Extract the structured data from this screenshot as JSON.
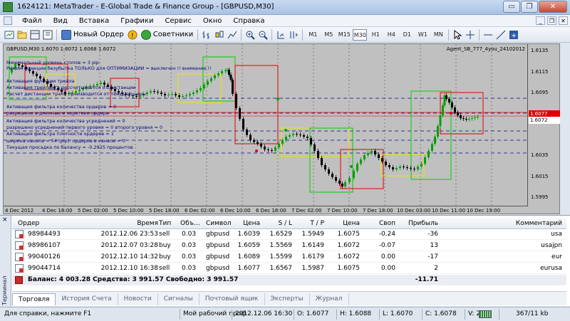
{
  "window": {
    "title": "1624121: MetaTrader - E-Global Trade & Finance Group - [GBPUSD,M30]",
    "buttons": [
      "▭",
      "❐",
      "✕"
    ]
  },
  "menu": {
    "items": [
      "Файл",
      "Вид",
      "Вставка",
      "Графики",
      "Сервис",
      "Окно",
      "Справка"
    ],
    "mdi_buttons": [
      "_",
      "❐",
      "✕"
    ]
  },
  "toolbar": {
    "new_order_label": "Новый Ордер",
    "experts_label": "Советники",
    "timeframes": [
      "M1",
      "M5",
      "M15",
      "M30",
      "H1",
      "H4",
      "D1",
      "W1",
      "MN"
    ],
    "active_timeframe": "M30"
  },
  "chart": {
    "symbol_header": "GBPUSD,M30  1.6070 1.6072 1.6068 1.6072",
    "ea_name": "Agent_SB_777_4you_24102012",
    "comments": [
      "Минимальный уровень стопов = 3 pip",
      "Режим функции безубытка ТОЛЬКО для ОПТИМИЗАЦИИ = выключен !! внимание !!",
      "Активация функции трейла",
      "Активация трейлинга рассчитывается от дистанции",
      "Расчет дистанции трала производится от текущей цены",
      "Активация фильтра количества ордеров = 0",
      "разрешено в длинные и короткие ордера",
      "Активация фильтра количества усреднений = 0",
      "разрешено усреднений первого уровня = 0 второго уровня = 0",
      "Активация фильтра плотности ордеров = 1",
      "ширина канала = 54 (pip), ордеров в канале = 0",
      "Текущая просадка по балансу = -0.2925 процентов"
    ],
    "price_labels": [
      "1.6135",
      "1.6115",
      "1.6095",
      "1.6035",
      "1.6015",
      "1.5995"
    ],
    "price_tag_red": "1.6077",
    "price_tag_white": "1.6072",
    "time_labels": [
      "4 Dec 2012",
      "4 Dec 18:00",
      "5 Dec 02:00",
      "5 Dec 10:00",
      "5 Dec 18:00",
      "6 Dec 02:00",
      "6 Dec 10:00",
      "6 Dec 18:00",
      "7 Dec 02:00",
      "7 Dec 10:00",
      "7 Dec 18:00",
      "10 Dec 03:00",
      "10 Dec 11:00",
      "10 Dec 19:00"
    ],
    "colors": {
      "background": "#c0c0c0",
      "bull": "#00a000",
      "bear": "#000000",
      "red_box": "#e00000",
      "green_box": "#00d000",
      "yellow_box": "#e8e800",
      "dashed": "#000080"
    }
  },
  "terminal": {
    "side_label": "Терминал",
    "columns": [
      "Ордер",
      "Время",
      "Тип",
      "Объ...",
      "Символ",
      "Цена",
      "S / L",
      "T / P",
      "Цена",
      "Своп",
      "Прибыль",
      "Комментарий"
    ],
    "rows": [
      [
        "98984493",
        "2012.12.06 23:53",
        "sell",
        "0.03",
        "gbpusd",
        "1.6039",
        "1.6529",
        "1.5949",
        "1.6075",
        "-0.24",
        "-36",
        "usa"
      ],
      [
        "98986107",
        "2012.12.07 03:28",
        "buy",
        "0.03",
        "gbpusd",
        "1.6059",
        "1.5569",
        "1.6149",
        "1.6072",
        "-0.07",
        "13",
        "usajpn"
      ],
      [
        "99040126",
        "2012.12.10 14:32",
        "buy",
        "0.03",
        "gbpusd",
        "1.6089",
        "1.5599",
        "1.6179",
        "1.6072",
        "0.00",
        "-17",
        "eur"
      ],
      [
        "99044714",
        "2012.12.10 16:38",
        "sell",
        "0.03",
        "gbpusd",
        "1.6077",
        "1.6567",
        "1.5987",
        "1.6075",
        "0.00",
        "2",
        "eurusa"
      ]
    ],
    "balance_text": "Баланс: 4 003.28  Средства: 3 991.57  Свободно: 3 991.57",
    "balance_profit": "-11.71",
    "tabs": [
      "Торговля",
      "История Счета",
      "Новости",
      "Сигналы",
      "Почтовый ящик",
      "Эксперты",
      "Журнал"
    ],
    "active_tab": "Торговля"
  },
  "status": {
    "help": "Для справки, нажмите F1",
    "profile": "Мой рабочий проф",
    "datetime": "2012.12.06 16:30",
    "open": "O: 1.6077",
    "high": "H: 1.6088",
    "low": "L: 1.6070",
    "close": "C: 1.6078",
    "volume": "V: 268",
    "traffic": "367/11 kb"
  }
}
